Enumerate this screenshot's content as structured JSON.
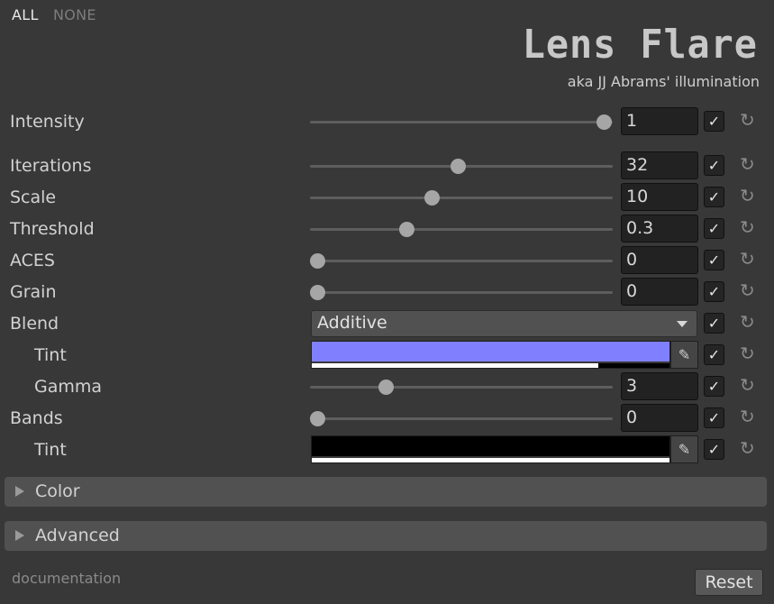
{
  "header": {
    "all_label": "ALL",
    "none_label": "NONE",
    "title": "Lens Flare",
    "subtitle": "aka JJ Abrams' illumination"
  },
  "rows": {
    "intensity": {
      "label": "Intensity",
      "value": "1",
      "slider": 1.0,
      "enabled": true
    },
    "iterations": {
      "label": "Iterations",
      "value": "32",
      "slider": 0.49,
      "enabled": true
    },
    "scale": {
      "label": "Scale",
      "value": "10",
      "slider": 0.4,
      "enabled": true
    },
    "threshold": {
      "label": "Threshold",
      "value": "0.3",
      "slider": 0.31,
      "enabled": true
    },
    "aces": {
      "label": "ACES",
      "value": "0",
      "slider": 0.0,
      "enabled": true
    },
    "grain": {
      "label": "Grain",
      "value": "0",
      "slider": 0.0,
      "enabled": true
    },
    "blend": {
      "label": "Blend",
      "value": "Additive",
      "enabled": true
    },
    "blend_tint": {
      "label": "Tint",
      "color": "#8080ff",
      "alpha": 0.8,
      "enabled": true
    },
    "gamma": {
      "label": "Gamma",
      "value": "3",
      "slider": 0.24,
      "enabled": true
    },
    "bands": {
      "label": "Bands",
      "value": "0",
      "slider": 0.0,
      "enabled": true
    },
    "bands_tint": {
      "label": "Tint",
      "color": "#000000",
      "alpha": 1.0,
      "enabled": true
    }
  },
  "icons": {
    "checkmark": "✓",
    "reset": "↻",
    "eyedropper": "✎"
  },
  "sections": {
    "color": "Color",
    "advanced": "Advanced"
  },
  "footer": {
    "documentation": "documentation",
    "reset": "Reset"
  }
}
